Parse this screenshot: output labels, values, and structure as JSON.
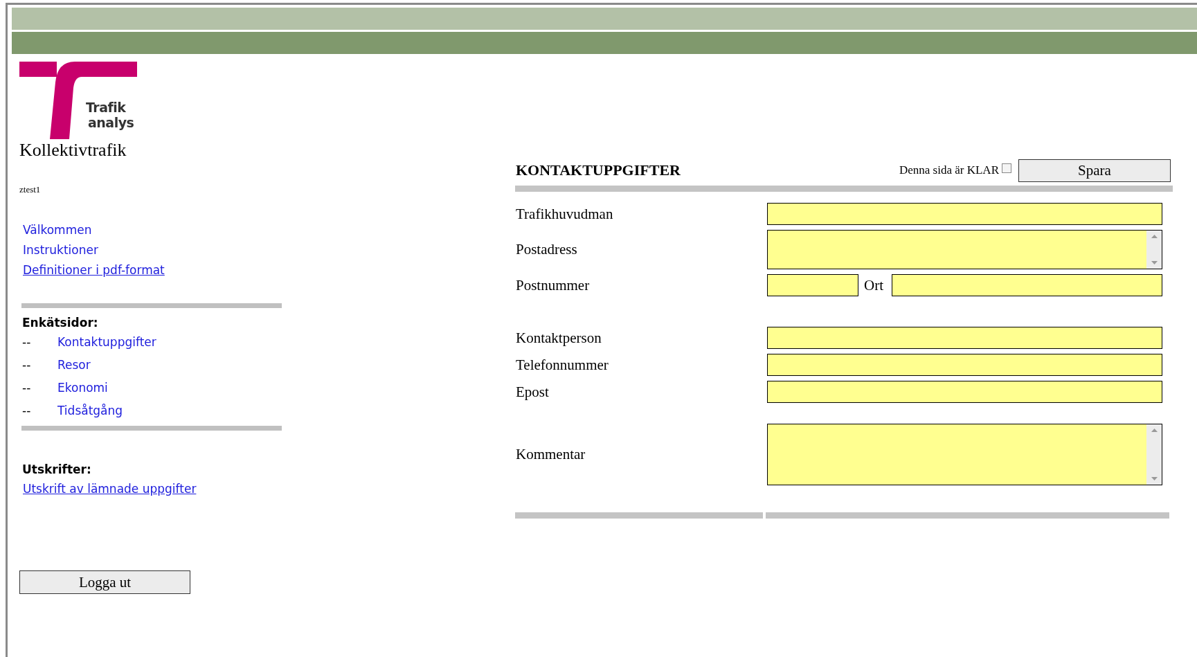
{
  "logo": {
    "lines": [
      "Trafik",
      "analys"
    ]
  },
  "site_title": "Kollektivtrafik",
  "user": "ztest1",
  "nav_links": [
    {
      "label": "Välkommen",
      "underlined": false
    },
    {
      "label": "Instruktioner",
      "underlined": false
    },
    {
      "label": "Definitioner i pdf-format",
      "underlined": true
    }
  ],
  "survey_pages": {
    "heading": "Enkätsidor:",
    "items": [
      {
        "marker": "--",
        "label": "Kontaktuppgifter"
      },
      {
        "marker": "--",
        "label": "Resor"
      },
      {
        "marker": "--",
        "label": "Ekonomi"
      },
      {
        "marker": "--",
        "label": "Tidsåtgång"
      }
    ]
  },
  "printouts": {
    "heading": "Utskrifter:",
    "links": [
      {
        "label": "Utskrift av lämnade uppgifter",
        "underlined": true
      }
    ]
  },
  "logout_button": "Logga ut",
  "form": {
    "title": "KONTAKTUPPGIFTER",
    "ready_checkbox": {
      "label": "Denna sida är KLAR",
      "checked": false
    },
    "save_button": "Spara",
    "groups": [
      [
        {
          "kind": "text",
          "label": "Trafikhuvudman"
        },
        {
          "kind": "textarea",
          "label": "Postadress"
        },
        {
          "kind": "postal",
          "label": "Postnummer",
          "second_label": "Ort"
        }
      ],
      [
        {
          "kind": "text",
          "label": "Kontaktperson"
        },
        {
          "kind": "text",
          "label": "Telefonnummer"
        },
        {
          "kind": "text",
          "label": "Epost"
        }
      ],
      [
        {
          "kind": "textarea",
          "label": "Kommentar"
        }
      ]
    ]
  }
}
